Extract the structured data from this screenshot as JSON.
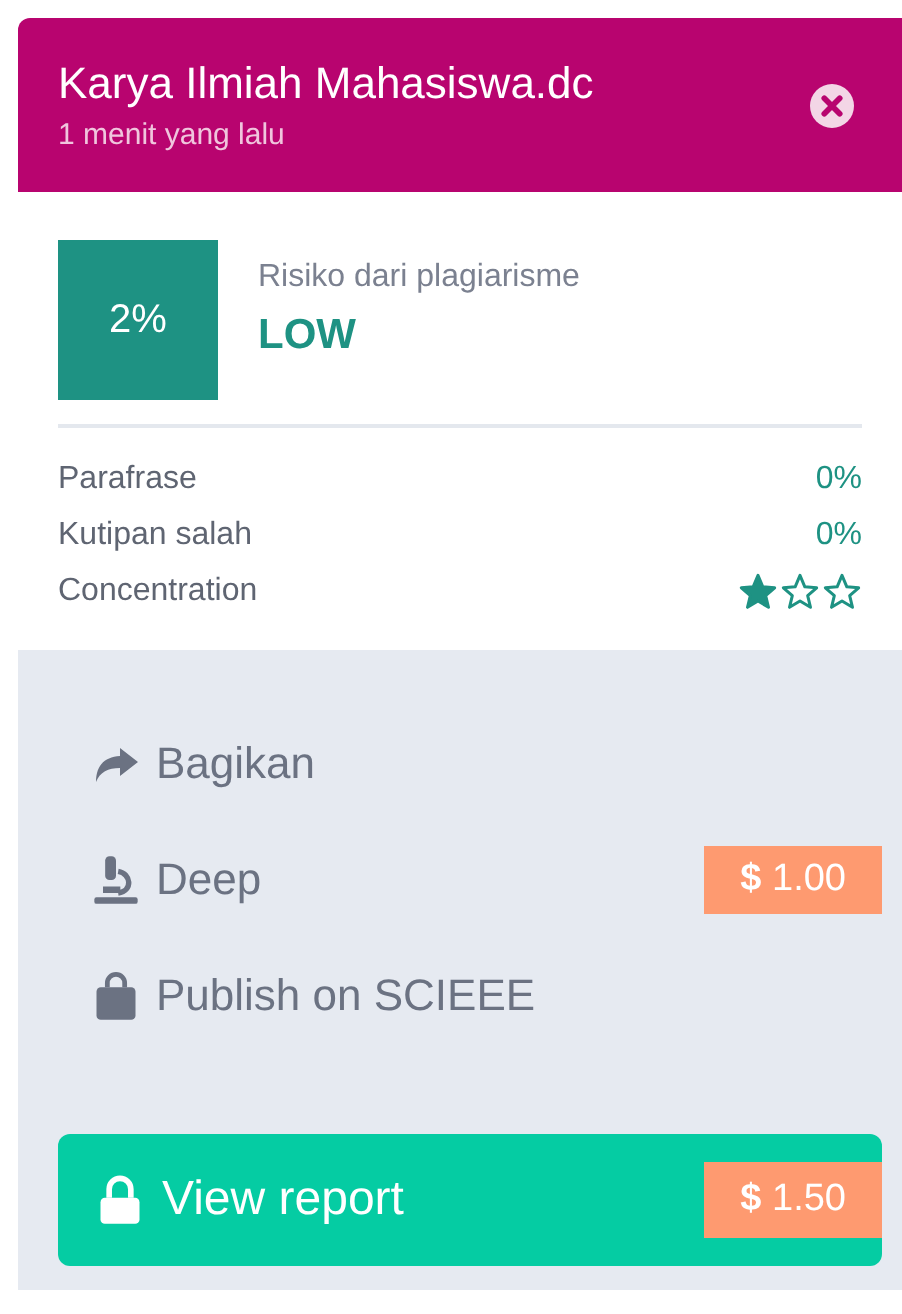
{
  "header": {
    "title": "Karya Ilmiah Mahasiswa.dc",
    "subtitle": "1 menit yang lalu"
  },
  "risk": {
    "percent": "2%",
    "label": "Risiko dari plagiarisme",
    "level_text": "LOW"
  },
  "metrics": [
    {
      "kind": "text",
      "label": "Parafrase",
      "value": "0%"
    },
    {
      "kind": "text",
      "label": "Kutipan salah",
      "value": "0%"
    },
    {
      "kind": "stars",
      "label": "Concentration",
      "stars": 1
    }
  ],
  "actions": [
    {
      "kind": "share",
      "label": "Bagikan"
    },
    {
      "kind": "microscope",
      "label": "Deep",
      "price": "**$** 1.00"
    },
    {
      "kind": "bag",
      "label": "Publish on SCIEEE"
    }
  ],
  "report_button": {
    "label": "View report",
    "price": "**$** 1.50"
  }
}
